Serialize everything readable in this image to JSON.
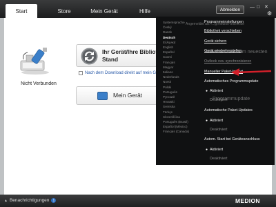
{
  "tabs": [
    {
      "label": "Start",
      "active": true
    },
    {
      "label": "Store"
    },
    {
      "label": "Mein Gerät"
    },
    {
      "label": "Hilfe"
    }
  ],
  "header": {
    "logout_label": "Abmelden",
    "settings_icon": "gear-icon"
  },
  "device": {
    "status": "Nicht Verbunden"
  },
  "sync_card": {
    "title": "Ihr Gerät/Ihre Bibliothek synchronisieren",
    "title_line2": "Stand"
  },
  "download_check": {
    "label": "Nach dem Download direkt auf mein Gerät übertragen",
    "checked": false
  },
  "my_device_button": {
    "label": "Mein Gerät"
  },
  "overlay_ghost": {
    "behind_title": "Angemeldet als: ...@medion-online.de",
    "behind_findet": "findet sich auf dem neuesten",
    "behind_programm": "Programmupdate"
  },
  "languages": [
    "Systemsprache",
    "Český",
    "Dansk",
    "Deutsch",
    "Ελληνικά",
    "English",
    "Español",
    "Suomi",
    "Français",
    "Magyar",
    "Italiano",
    "Nederlands",
    "Norsk",
    "Polski",
    "Português",
    "Русский",
    "Hrvatski",
    "Svenska",
    "Türkçe",
    "Slovenščina",
    "Português (Brasil)",
    "Español (México)",
    "Français (Canada)"
  ],
  "selected_language": "Deutsch",
  "settings_menu": {
    "program_settings": "Programmeinstellungen",
    "move_library": "Bibliothek verschieben",
    "backup_device": "Gerät sichern",
    "restore_device": "Gerät wiederherstellen",
    "outlook_sync": "Outlook neu synchronisieren",
    "manual_package_import": "Manueller Paket-Import",
    "auto_program_updates": "Automatisches Programmupdate",
    "auto_package_updates": "Automatische Paket-Updates",
    "auto_start_on_connect": "Autom. Start bei Geräteanschluss",
    "enabled": "Aktiviert",
    "disabled": "Deaktiviert"
  },
  "statusbar": {
    "notifications_label": "Benachrichtigungen",
    "badge_count": "1",
    "brand": "MEDION"
  },
  "colors": {
    "accent": "#2d6fc1",
    "overlay_bg": "#101112",
    "arrow": "#d4202a"
  }
}
